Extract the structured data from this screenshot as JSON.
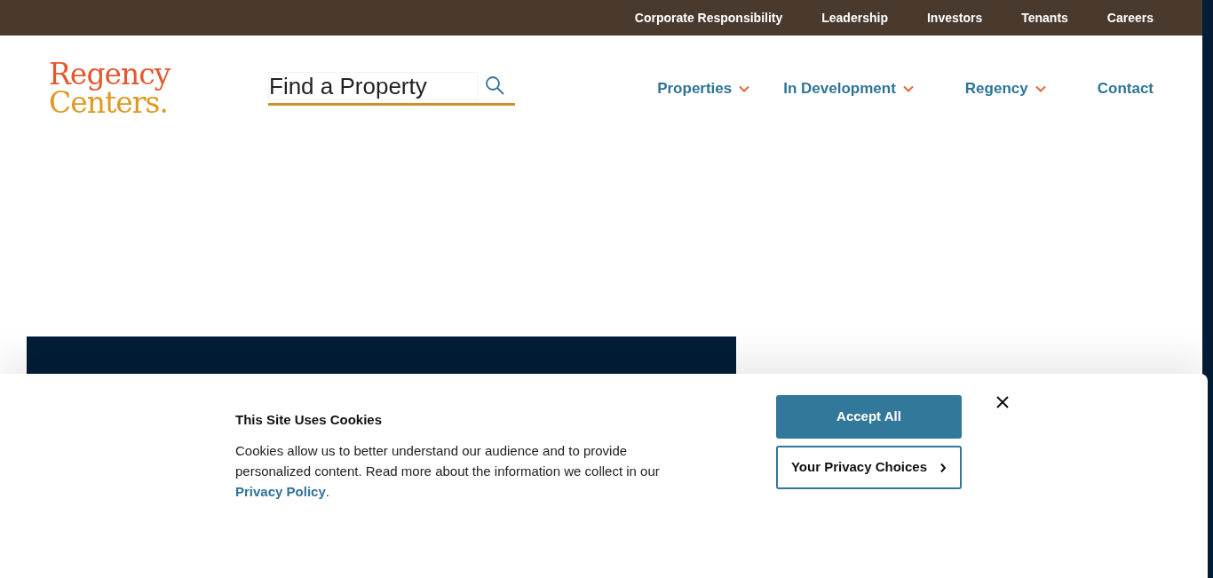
{
  "top_links": [
    "Corporate Responsibility",
    "Leadership",
    "Investors",
    "Tenants",
    "Careers"
  ],
  "logo": {
    "line_1": "Regency",
    "line_2": "Centers."
  },
  "search": {
    "placeholder": "Find a Property"
  },
  "nav": [
    {
      "label": "Properties",
      "has_menu": true
    },
    {
      "label": "In Development",
      "has_menu": true
    },
    {
      "label": "Regency",
      "has_menu": true
    },
    {
      "label": "Contact",
      "has_menu": false
    }
  ],
  "cookie_banner": {
    "title": "This Site Uses Cookies",
    "text": "Cookies allow us to better understand our audience and to provide personalized content. Read more about the information we collect in our",
    "link": "Privacy Policy",
    "after_link": ".",
    "accept": "Accept All",
    "choices": "Your Privacy Choices"
  }
}
